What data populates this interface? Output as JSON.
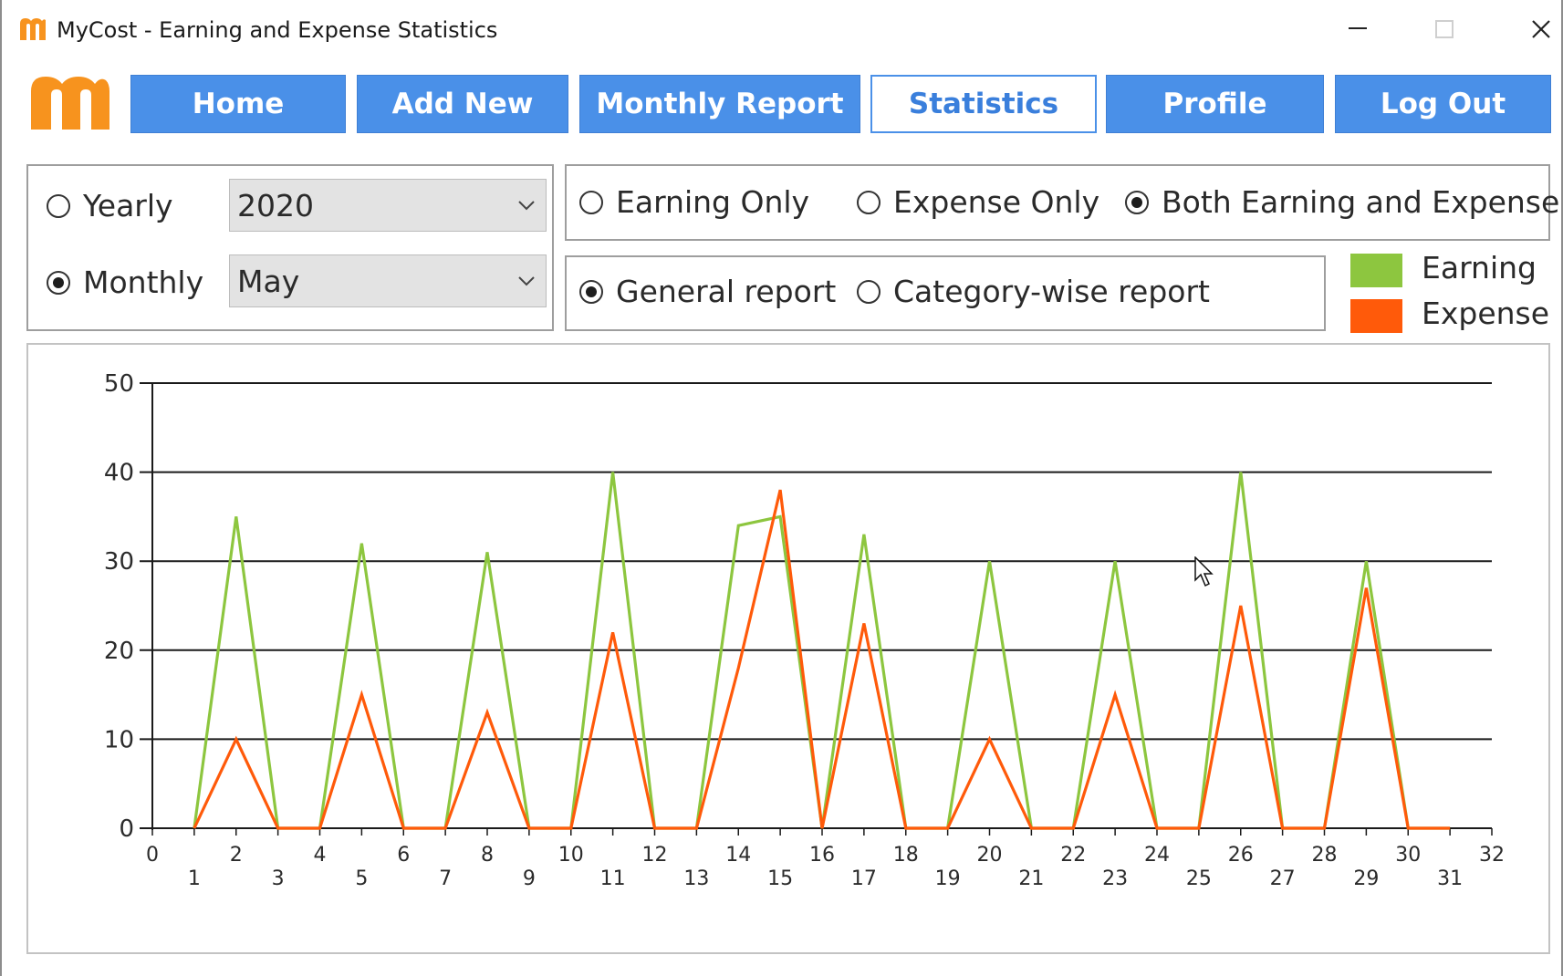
{
  "window": {
    "title": "MyCost - Earning and Expense Statistics",
    "app_icon": "mycost-logo-icon",
    "controls": [
      "minimize-icon",
      "maximize-icon",
      "close-icon"
    ]
  },
  "nav": {
    "logo": "mycost-logo",
    "buttons": [
      {
        "label": "Home",
        "active": false
      },
      {
        "label": "Add New",
        "active": false
      },
      {
        "label": "Monthly Report",
        "active": false
      },
      {
        "label": "Statistics",
        "active": true
      },
      {
        "label": "Profile",
        "active": false
      },
      {
        "label": "Log Out",
        "active": false
      }
    ]
  },
  "period": {
    "yearly_label": "Yearly",
    "monthly_label": "Monthly",
    "selected": "Monthly",
    "year_value": "2020",
    "month_value": "May"
  },
  "type": {
    "earning_only": "Earning Only",
    "expense_only": "Expense Only",
    "both": "Both Earning and Expense",
    "selected": "Both Earning and Expense"
  },
  "report": {
    "general": "General report",
    "category": "Category-wise report",
    "selected": "General report"
  },
  "legend": [
    {
      "label": "Earning",
      "color": "#8dc63f"
    },
    {
      "label": "Expense",
      "color": "#ff5a0a"
    }
  ],
  "colors": {
    "nav_bg": "#4a90e8",
    "earning": "#8dc63f",
    "expense": "#ff5a0a",
    "logo": "#f7931e"
  },
  "chart_data": {
    "type": "line",
    "x": [
      1,
      2,
      3,
      4,
      5,
      6,
      7,
      8,
      9,
      10,
      11,
      12,
      13,
      14,
      15,
      16,
      17,
      18,
      19,
      20,
      21,
      22,
      23,
      24,
      25,
      26,
      27,
      28,
      29,
      30,
      31
    ],
    "xlim": [
      0,
      32
    ],
    "x_ticks": [
      0,
      1,
      2,
      3,
      4,
      5,
      6,
      7,
      8,
      9,
      10,
      11,
      12,
      13,
      14,
      15,
      16,
      17,
      18,
      19,
      20,
      21,
      22,
      23,
      24,
      25,
      26,
      27,
      28,
      29,
      30,
      31,
      32
    ],
    "ylim": [
      0,
      50
    ],
    "y_ticks": [
      0,
      10,
      20,
      30,
      40,
      50
    ],
    "grid": "horizontal",
    "legend": "top-right",
    "series": [
      {
        "name": "Earning",
        "color": "#8dc63f",
        "values": [
          0,
          35,
          0,
          0,
          32,
          0,
          0,
          31,
          0,
          0,
          40,
          0,
          0,
          34,
          35,
          0,
          33,
          0,
          0,
          30,
          0,
          0,
          30,
          0,
          0,
          40,
          0,
          0,
          30,
          0,
          0
        ]
      },
      {
        "name": "Expense",
        "color": "#ff5a0a",
        "values": [
          0,
          10,
          0,
          0,
          15,
          0,
          0,
          13,
          0,
          0,
          22,
          0,
          0,
          18,
          38,
          0,
          23,
          0,
          0,
          10,
          0,
          0,
          15,
          0,
          0,
          25,
          0,
          0,
          27,
          0,
          0
        ]
      }
    ]
  }
}
